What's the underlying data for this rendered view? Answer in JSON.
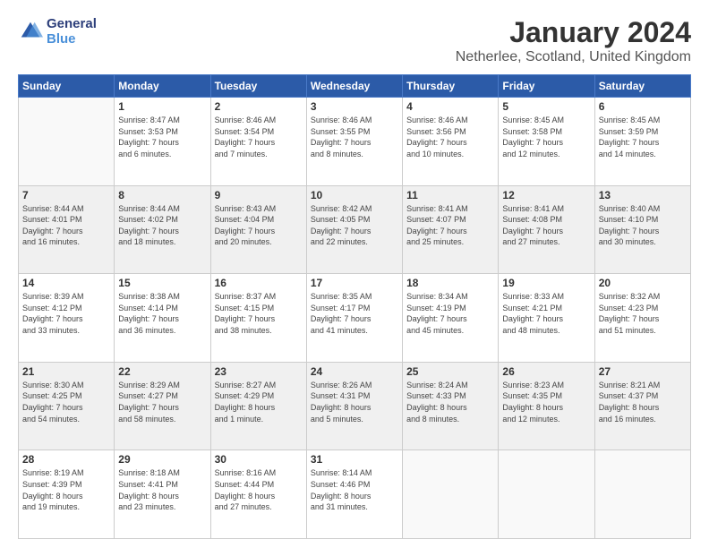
{
  "logo": {
    "line1": "General",
    "line2": "Blue"
  },
  "title": "January 2024",
  "subtitle": "Netherlee, Scotland, United Kingdom",
  "days_header": [
    "Sunday",
    "Monday",
    "Tuesday",
    "Wednesday",
    "Thursday",
    "Friday",
    "Saturday"
  ],
  "weeks": [
    [
      {
        "day": "",
        "info": ""
      },
      {
        "day": "1",
        "info": "Sunrise: 8:47 AM\nSunset: 3:53 PM\nDaylight: 7 hours\nand 6 minutes."
      },
      {
        "day": "2",
        "info": "Sunrise: 8:46 AM\nSunset: 3:54 PM\nDaylight: 7 hours\nand 7 minutes."
      },
      {
        "day": "3",
        "info": "Sunrise: 8:46 AM\nSunset: 3:55 PM\nDaylight: 7 hours\nand 8 minutes."
      },
      {
        "day": "4",
        "info": "Sunrise: 8:46 AM\nSunset: 3:56 PM\nDaylight: 7 hours\nand 10 minutes."
      },
      {
        "day": "5",
        "info": "Sunrise: 8:45 AM\nSunset: 3:58 PM\nDaylight: 7 hours\nand 12 minutes."
      },
      {
        "day": "6",
        "info": "Sunrise: 8:45 AM\nSunset: 3:59 PM\nDaylight: 7 hours\nand 14 minutes."
      }
    ],
    [
      {
        "day": "7",
        "info": "Sunrise: 8:44 AM\nSunset: 4:01 PM\nDaylight: 7 hours\nand 16 minutes."
      },
      {
        "day": "8",
        "info": "Sunrise: 8:44 AM\nSunset: 4:02 PM\nDaylight: 7 hours\nand 18 minutes."
      },
      {
        "day": "9",
        "info": "Sunrise: 8:43 AM\nSunset: 4:04 PM\nDaylight: 7 hours\nand 20 minutes."
      },
      {
        "day": "10",
        "info": "Sunrise: 8:42 AM\nSunset: 4:05 PM\nDaylight: 7 hours\nand 22 minutes."
      },
      {
        "day": "11",
        "info": "Sunrise: 8:41 AM\nSunset: 4:07 PM\nDaylight: 7 hours\nand 25 minutes."
      },
      {
        "day": "12",
        "info": "Sunrise: 8:41 AM\nSunset: 4:08 PM\nDaylight: 7 hours\nand 27 minutes."
      },
      {
        "day": "13",
        "info": "Sunrise: 8:40 AM\nSunset: 4:10 PM\nDaylight: 7 hours\nand 30 minutes."
      }
    ],
    [
      {
        "day": "14",
        "info": "Sunrise: 8:39 AM\nSunset: 4:12 PM\nDaylight: 7 hours\nand 33 minutes."
      },
      {
        "day": "15",
        "info": "Sunrise: 8:38 AM\nSunset: 4:14 PM\nDaylight: 7 hours\nand 36 minutes."
      },
      {
        "day": "16",
        "info": "Sunrise: 8:37 AM\nSunset: 4:15 PM\nDaylight: 7 hours\nand 38 minutes."
      },
      {
        "day": "17",
        "info": "Sunrise: 8:35 AM\nSunset: 4:17 PM\nDaylight: 7 hours\nand 41 minutes."
      },
      {
        "day": "18",
        "info": "Sunrise: 8:34 AM\nSunset: 4:19 PM\nDaylight: 7 hours\nand 45 minutes."
      },
      {
        "day": "19",
        "info": "Sunrise: 8:33 AM\nSunset: 4:21 PM\nDaylight: 7 hours\nand 48 minutes."
      },
      {
        "day": "20",
        "info": "Sunrise: 8:32 AM\nSunset: 4:23 PM\nDaylight: 7 hours\nand 51 minutes."
      }
    ],
    [
      {
        "day": "21",
        "info": "Sunrise: 8:30 AM\nSunset: 4:25 PM\nDaylight: 7 hours\nand 54 minutes."
      },
      {
        "day": "22",
        "info": "Sunrise: 8:29 AM\nSunset: 4:27 PM\nDaylight: 7 hours\nand 58 minutes."
      },
      {
        "day": "23",
        "info": "Sunrise: 8:27 AM\nSunset: 4:29 PM\nDaylight: 8 hours\nand 1 minute."
      },
      {
        "day": "24",
        "info": "Sunrise: 8:26 AM\nSunset: 4:31 PM\nDaylight: 8 hours\nand 5 minutes."
      },
      {
        "day": "25",
        "info": "Sunrise: 8:24 AM\nSunset: 4:33 PM\nDaylight: 8 hours\nand 8 minutes."
      },
      {
        "day": "26",
        "info": "Sunrise: 8:23 AM\nSunset: 4:35 PM\nDaylight: 8 hours\nand 12 minutes."
      },
      {
        "day": "27",
        "info": "Sunrise: 8:21 AM\nSunset: 4:37 PM\nDaylight: 8 hours\nand 16 minutes."
      }
    ],
    [
      {
        "day": "28",
        "info": "Sunrise: 8:19 AM\nSunset: 4:39 PM\nDaylight: 8 hours\nand 19 minutes."
      },
      {
        "day": "29",
        "info": "Sunrise: 8:18 AM\nSunset: 4:41 PM\nDaylight: 8 hours\nand 23 minutes."
      },
      {
        "day": "30",
        "info": "Sunrise: 8:16 AM\nSunset: 4:44 PM\nDaylight: 8 hours\nand 27 minutes."
      },
      {
        "day": "31",
        "info": "Sunrise: 8:14 AM\nSunset: 4:46 PM\nDaylight: 8 hours\nand 31 minutes."
      },
      {
        "day": "",
        "info": ""
      },
      {
        "day": "",
        "info": ""
      },
      {
        "day": "",
        "info": ""
      }
    ]
  ]
}
